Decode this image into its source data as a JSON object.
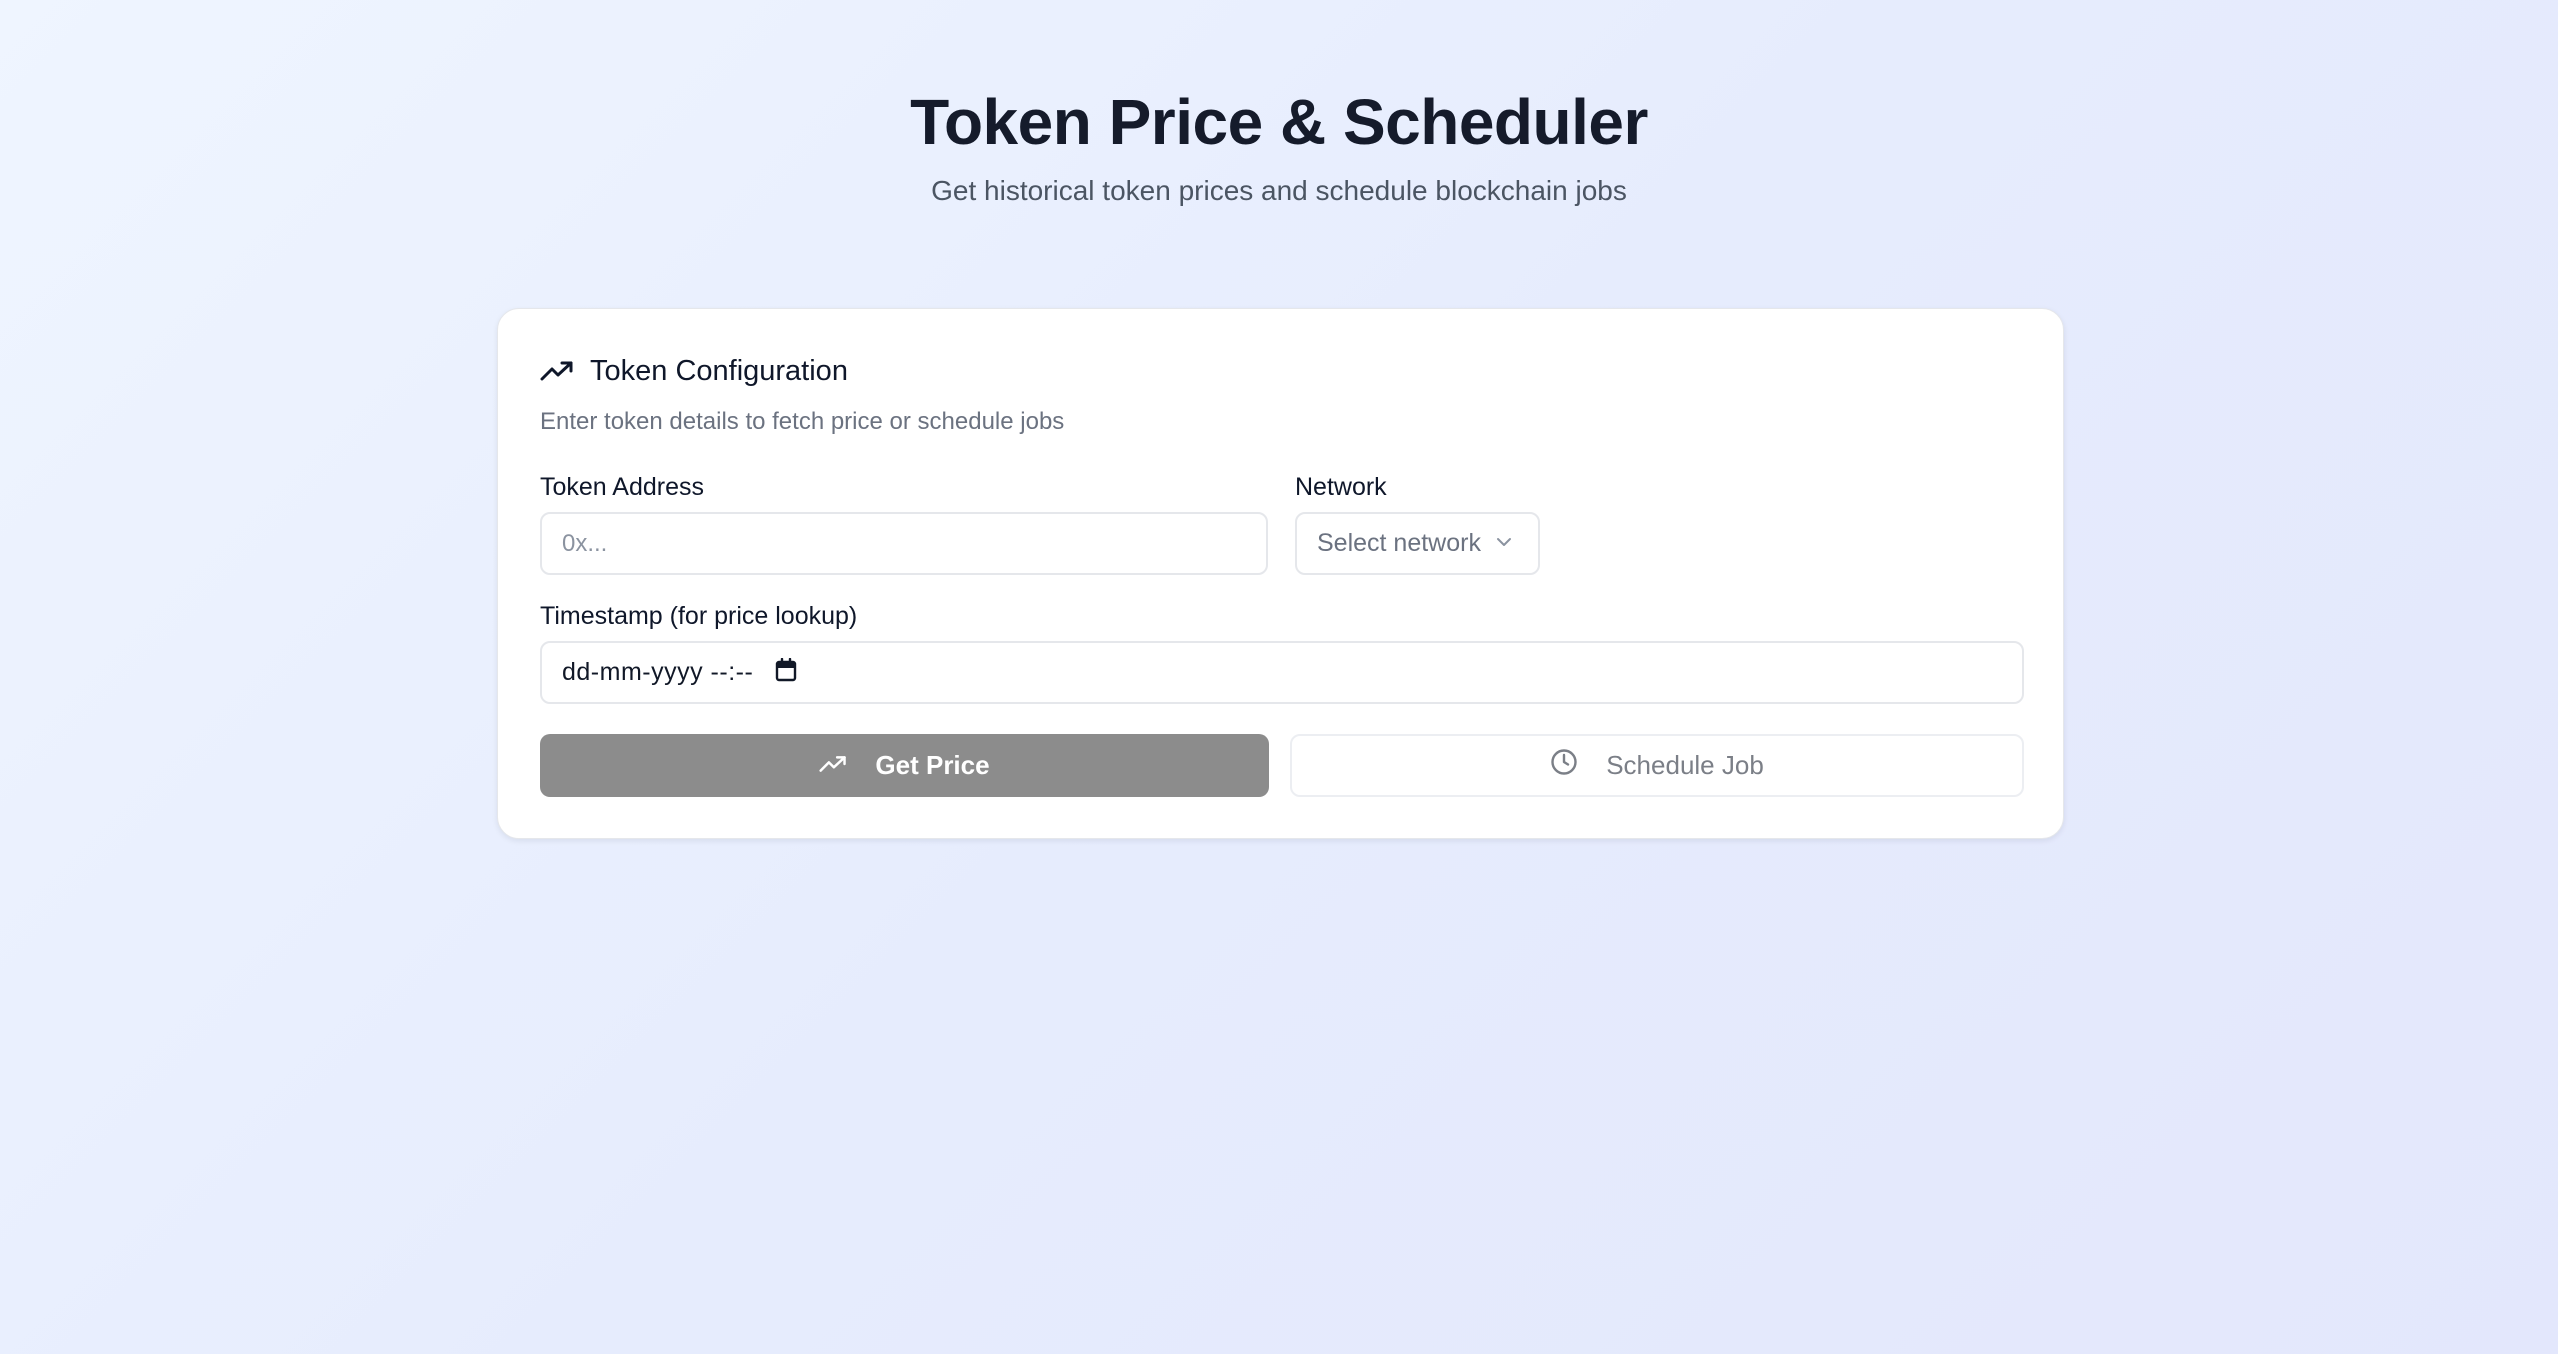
{
  "header": {
    "title": "Token Price & Scheduler",
    "subtitle": "Get historical token prices and schedule blockchain jobs"
  },
  "card": {
    "title": "Token Configuration",
    "title_icon": "trending-up-icon",
    "subtitle": "Enter token details to fetch price or schedule jobs"
  },
  "form": {
    "token_address": {
      "label": "Token Address",
      "placeholder": "0x...",
      "value": ""
    },
    "network": {
      "label": "Network",
      "selected": "Select network",
      "icon": "chevron-down-icon"
    },
    "timestamp": {
      "label": "Timestamp (for price lookup)",
      "value": "dd-mm-yyyy --:--",
      "icon": "calendar-icon"
    }
  },
  "actions": {
    "get_price": {
      "label": "Get Price",
      "icon": "trending-up-icon"
    },
    "schedule_job": {
      "label": "Schedule Job",
      "icon": "clock-icon"
    }
  },
  "colors": {
    "primary_button_bg": "#8c8c8c",
    "title_text": "#151b2b",
    "muted_text": "#6b7280"
  }
}
